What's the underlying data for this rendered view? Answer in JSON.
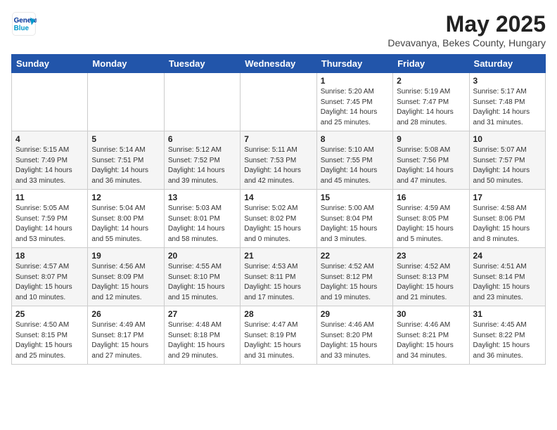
{
  "header": {
    "logo_line1": "General",
    "logo_line2": "Blue",
    "month": "May 2025",
    "location": "Devavanya, Bekes County, Hungary"
  },
  "days_of_week": [
    "Sunday",
    "Monday",
    "Tuesday",
    "Wednesday",
    "Thursday",
    "Friday",
    "Saturday"
  ],
  "weeks": [
    [
      {
        "day": "",
        "info": ""
      },
      {
        "day": "",
        "info": ""
      },
      {
        "day": "",
        "info": ""
      },
      {
        "day": "",
        "info": ""
      },
      {
        "day": "1",
        "info": "Sunrise: 5:20 AM\nSunset: 7:45 PM\nDaylight: 14 hours\nand 25 minutes."
      },
      {
        "day": "2",
        "info": "Sunrise: 5:19 AM\nSunset: 7:47 PM\nDaylight: 14 hours\nand 28 minutes."
      },
      {
        "day": "3",
        "info": "Sunrise: 5:17 AM\nSunset: 7:48 PM\nDaylight: 14 hours\nand 31 minutes."
      }
    ],
    [
      {
        "day": "4",
        "info": "Sunrise: 5:15 AM\nSunset: 7:49 PM\nDaylight: 14 hours\nand 33 minutes."
      },
      {
        "day": "5",
        "info": "Sunrise: 5:14 AM\nSunset: 7:51 PM\nDaylight: 14 hours\nand 36 minutes."
      },
      {
        "day": "6",
        "info": "Sunrise: 5:12 AM\nSunset: 7:52 PM\nDaylight: 14 hours\nand 39 minutes."
      },
      {
        "day": "7",
        "info": "Sunrise: 5:11 AM\nSunset: 7:53 PM\nDaylight: 14 hours\nand 42 minutes."
      },
      {
        "day": "8",
        "info": "Sunrise: 5:10 AM\nSunset: 7:55 PM\nDaylight: 14 hours\nand 45 minutes."
      },
      {
        "day": "9",
        "info": "Sunrise: 5:08 AM\nSunset: 7:56 PM\nDaylight: 14 hours\nand 47 minutes."
      },
      {
        "day": "10",
        "info": "Sunrise: 5:07 AM\nSunset: 7:57 PM\nDaylight: 14 hours\nand 50 minutes."
      }
    ],
    [
      {
        "day": "11",
        "info": "Sunrise: 5:05 AM\nSunset: 7:59 PM\nDaylight: 14 hours\nand 53 minutes."
      },
      {
        "day": "12",
        "info": "Sunrise: 5:04 AM\nSunset: 8:00 PM\nDaylight: 14 hours\nand 55 minutes."
      },
      {
        "day": "13",
        "info": "Sunrise: 5:03 AM\nSunset: 8:01 PM\nDaylight: 14 hours\nand 58 minutes."
      },
      {
        "day": "14",
        "info": "Sunrise: 5:02 AM\nSunset: 8:02 PM\nDaylight: 15 hours\nand 0 minutes."
      },
      {
        "day": "15",
        "info": "Sunrise: 5:00 AM\nSunset: 8:04 PM\nDaylight: 15 hours\nand 3 minutes."
      },
      {
        "day": "16",
        "info": "Sunrise: 4:59 AM\nSunset: 8:05 PM\nDaylight: 15 hours\nand 5 minutes."
      },
      {
        "day": "17",
        "info": "Sunrise: 4:58 AM\nSunset: 8:06 PM\nDaylight: 15 hours\nand 8 minutes."
      }
    ],
    [
      {
        "day": "18",
        "info": "Sunrise: 4:57 AM\nSunset: 8:07 PM\nDaylight: 15 hours\nand 10 minutes."
      },
      {
        "day": "19",
        "info": "Sunrise: 4:56 AM\nSunset: 8:09 PM\nDaylight: 15 hours\nand 12 minutes."
      },
      {
        "day": "20",
        "info": "Sunrise: 4:55 AM\nSunset: 8:10 PM\nDaylight: 15 hours\nand 15 minutes."
      },
      {
        "day": "21",
        "info": "Sunrise: 4:53 AM\nSunset: 8:11 PM\nDaylight: 15 hours\nand 17 minutes."
      },
      {
        "day": "22",
        "info": "Sunrise: 4:52 AM\nSunset: 8:12 PM\nDaylight: 15 hours\nand 19 minutes."
      },
      {
        "day": "23",
        "info": "Sunrise: 4:52 AM\nSunset: 8:13 PM\nDaylight: 15 hours\nand 21 minutes."
      },
      {
        "day": "24",
        "info": "Sunrise: 4:51 AM\nSunset: 8:14 PM\nDaylight: 15 hours\nand 23 minutes."
      }
    ],
    [
      {
        "day": "25",
        "info": "Sunrise: 4:50 AM\nSunset: 8:15 PM\nDaylight: 15 hours\nand 25 minutes."
      },
      {
        "day": "26",
        "info": "Sunrise: 4:49 AM\nSunset: 8:17 PM\nDaylight: 15 hours\nand 27 minutes."
      },
      {
        "day": "27",
        "info": "Sunrise: 4:48 AM\nSunset: 8:18 PM\nDaylight: 15 hours\nand 29 minutes."
      },
      {
        "day": "28",
        "info": "Sunrise: 4:47 AM\nSunset: 8:19 PM\nDaylight: 15 hours\nand 31 minutes."
      },
      {
        "day": "29",
        "info": "Sunrise: 4:46 AM\nSunset: 8:20 PM\nDaylight: 15 hours\nand 33 minutes."
      },
      {
        "day": "30",
        "info": "Sunrise: 4:46 AM\nSunset: 8:21 PM\nDaylight: 15 hours\nand 34 minutes."
      },
      {
        "day": "31",
        "info": "Sunrise: 4:45 AM\nSunset: 8:22 PM\nDaylight: 15 hours\nand 36 minutes."
      }
    ]
  ]
}
